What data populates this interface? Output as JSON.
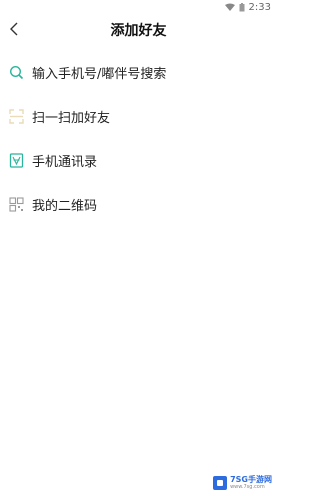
{
  "status_bar": {
    "time": "2:33"
  },
  "header": {
    "title": "添加好友"
  },
  "menu": {
    "items": [
      {
        "label": "输入手机号/嘟伴号搜索",
        "icon": "search-icon"
      },
      {
        "label": "扫一扫加好友",
        "icon": "scan-icon"
      },
      {
        "label": "手机通讯录",
        "icon": "contacts-icon"
      },
      {
        "label": "我的二维码",
        "icon": "qrcode-icon"
      }
    ]
  },
  "watermark": {
    "text": "7SG手游网",
    "subtext": "www.7sg.com"
  },
  "colors": {
    "accent": "#2bb59a",
    "title": "#111111",
    "watermark": "#2d6cdf"
  }
}
